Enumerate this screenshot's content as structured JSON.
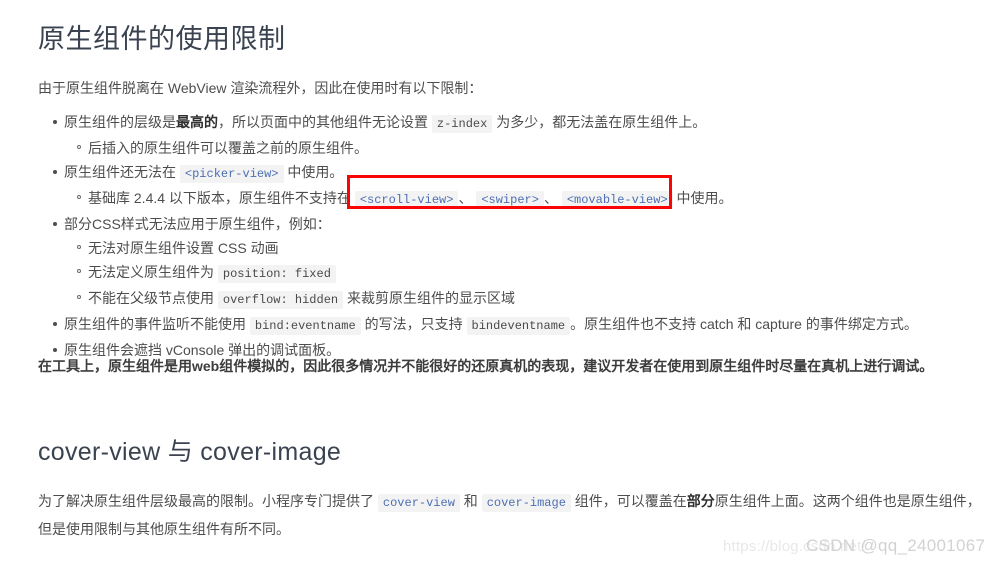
{
  "document": {
    "title": "原生组件的使用限制",
    "intro": "由于原生组件脱离在 WebView 渲染流程外，因此在使用时有以下限制："
  },
  "limits": {
    "item1": {
      "pre_bold": "原生组件的层级是",
      "bold": "最高的",
      "mid": "，所以页面中的其他组件无论设置",
      "code": "z-index",
      "post": "为多少，都无法盖在原生组件上。",
      "sub1": "后插入的原生组件可以覆盖之前的原生组件。"
    },
    "item2": {
      "pre": "原生组件还无法在",
      "code": "<picker-view>",
      "post": "中使用。",
      "sub1_pre": "基础库 2.4.4 以下版本，原生组件不支持在",
      "sub1_code1": "<scroll-view>",
      "sub1_sep1": "、",
      "sub1_code2": "<swiper>",
      "sub1_sep2": "、",
      "sub1_code3": "<movable-view>",
      "sub1_post": "中使用。"
    },
    "item3": {
      "text": "部分CSS样式无法应用于原生组件，例如：",
      "sub1": "无法对原生组件设置 CSS 动画",
      "sub2_pre": "无法定义原生组件为",
      "sub2_code": "position: fixed",
      "sub3_pre": "不能在父级节点使用",
      "sub3_code": "overflow: hidden",
      "sub3_post": "来裁剪原生组件的显示区域"
    },
    "item4": {
      "pre": "原生组件的事件监听不能使用",
      "code1": "bind:eventname",
      "mid": "的写法，只支持",
      "code2": "bindeventname",
      "post": "。原生组件也不支持 catch 和 capture 的事件绑定方式。"
    },
    "item5": {
      "text": "原生组件会遮挡 vConsole 弹出的调试面板。"
    }
  },
  "tool_note": {
    "pre": "在工具上，原生组件是用",
    "web": "web",
    "post": "组件模拟的，因此很多情况并不能很好的还原真机的表现，建议开发者在使用到原生组件时尽量在真机上进行调试。"
  },
  "cover_section": {
    "title": "cover-view 与 cover-image",
    "para_1": "为了解决原生组件层级最高的限制。小程序专门提供了",
    "code1": "cover-view",
    "para_2": "和",
    "code2": "cover-image",
    "para_3": "组件，可以覆盖在",
    "bold": "部分",
    "para_4": "原生组件上面。这两个组件也是原生组件，",
    "para_5": "但是使用限制与其他原生组件有所不同。"
  },
  "annotation": {
    "red_box_color": "#fa0505"
  },
  "watermarks": {
    "url": "https://blog.csdn.net/",
    "csdn": "CSDN @qq_24001067"
  }
}
